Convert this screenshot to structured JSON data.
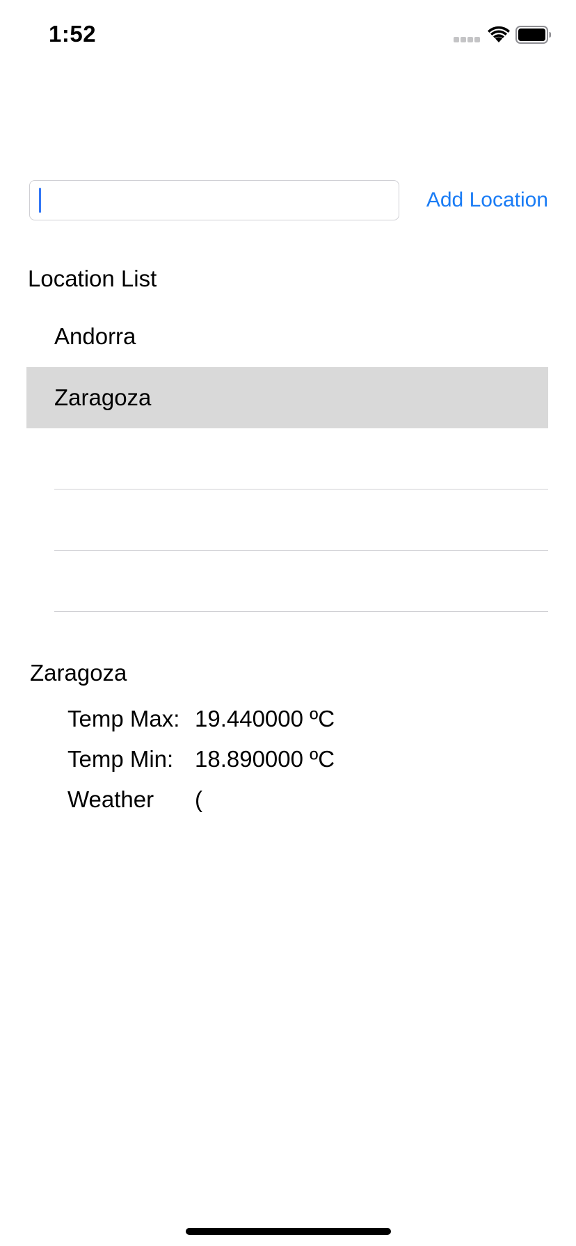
{
  "status_bar": {
    "time": "1:52",
    "signal_icon": "signal-dots-icon",
    "wifi_icon": "wifi-icon",
    "battery_icon": "battery-full-icon"
  },
  "add_location": {
    "input_value": "",
    "button_label": "Add Location",
    "accent_color": "#1a7cf5"
  },
  "location_list": {
    "title": "Location List",
    "items": [
      {
        "label": "Andorra",
        "selected": false
      },
      {
        "label": "Zaragoza",
        "selected": true
      },
      {
        "label": "",
        "selected": false
      },
      {
        "label": "",
        "selected": false
      },
      {
        "label": "",
        "selected": false
      }
    ],
    "selected_row_color": "#d9d9d9"
  },
  "weather_detail": {
    "city": "Zaragoza",
    "rows": [
      {
        "label": "Temp Max:",
        "value": "19.440000 ºC"
      },
      {
        "label": "Temp Min:",
        "value": "18.890000 ºC"
      },
      {
        "label": "Weather",
        "value": "("
      }
    ]
  }
}
